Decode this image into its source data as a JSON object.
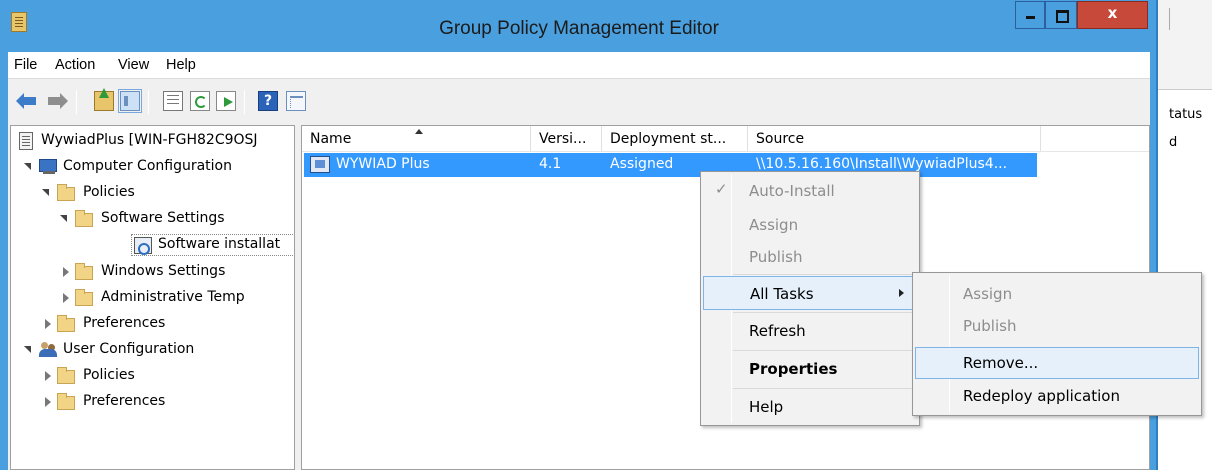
{
  "window": {
    "title": "Group Policy Management Editor",
    "close_label": "x"
  },
  "menubar": [
    "File",
    "Action",
    "View",
    "Help"
  ],
  "toolbar": {
    "help_label": "?"
  },
  "background_window": {
    "header": "tatus",
    "value": "d"
  },
  "tree": [
    {
      "label": "WywiadPlus [WIN-FGH82C9OSJ"
    },
    {
      "label": "Computer Configuration"
    },
    {
      "label": "Policies"
    },
    {
      "label": "Software Settings"
    },
    {
      "label": "Software installat"
    },
    {
      "label": "Windows Settings"
    },
    {
      "label": "Administrative Temp"
    },
    {
      "label": "Preferences"
    },
    {
      "label": "User Configuration"
    },
    {
      "label": "Policies"
    },
    {
      "label": "Preferences"
    }
  ],
  "list": {
    "columns": [
      "Name",
      "Versi...",
      "Deployment st...",
      "Source"
    ],
    "rows": [
      {
        "name": "WYWIAD Plus",
        "version": "4.1",
        "deployment": "Assigned",
        "source": "\\\\10.5.16.160\\Install\\WywiadPlus4..."
      }
    ]
  },
  "context_menu": {
    "items": [
      {
        "label": "Auto-Install",
        "checked": true
      },
      {
        "label": "Assign"
      },
      {
        "label": "Publish"
      },
      {
        "label": "All Tasks"
      },
      {
        "label": "Refresh"
      },
      {
        "label": "Properties"
      },
      {
        "label": "Help"
      }
    ],
    "check_glyph": "✓"
  },
  "submenu": {
    "items": [
      {
        "label": "Assign"
      },
      {
        "label": "Publish"
      },
      {
        "label": "Remove..."
      },
      {
        "label": "Redeploy application"
      }
    ]
  }
}
